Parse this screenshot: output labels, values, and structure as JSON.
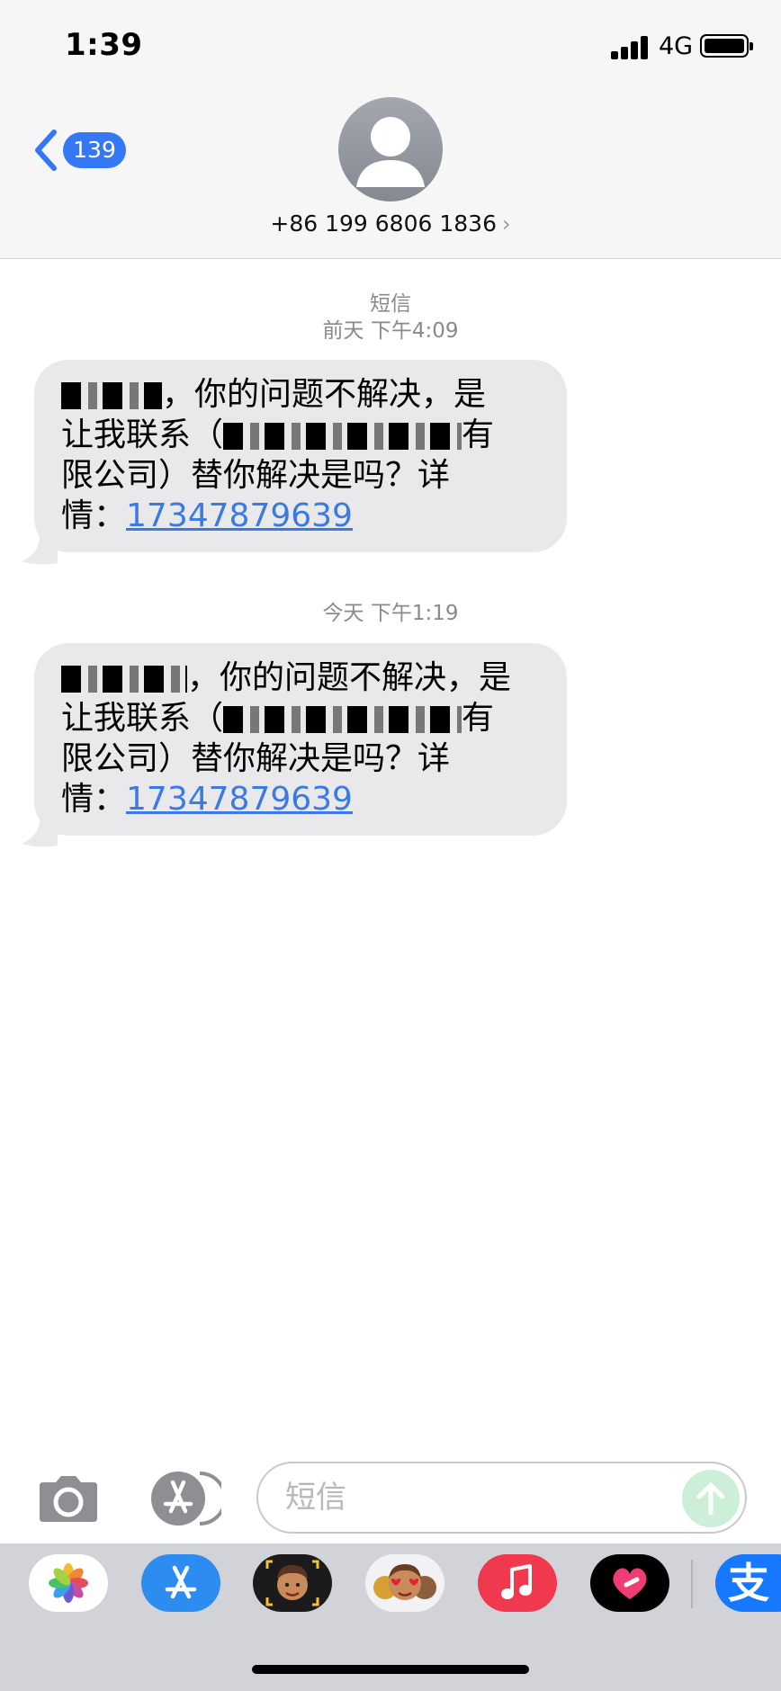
{
  "status_bar": {
    "time": "1:39",
    "network": "4G"
  },
  "nav": {
    "back_count": "139",
    "contact_number": "+86 199 6806 1836"
  },
  "thread": {
    "service_label": "短信",
    "messages": [
      {
        "timestamp": "前天 下午4:09",
        "line1": "，你的问题不解决，是",
        "line2_start": "让我联系（",
        "line2_end": "有",
        "line3": "限公司）替你解决是吗？详",
        "line4_prefix": "情：",
        "link": "17347879639"
      },
      {
        "timestamp": "今天 下午1:19",
        "line1": "，你的问题不解决，是",
        "line2_start": "让我联系（",
        "line2_end": "有",
        "line3": "限公司）替你解决是吗？详",
        "line4_prefix": "情：",
        "link": "17347879639"
      }
    ]
  },
  "composer": {
    "placeholder": "短信"
  },
  "app_drawer": {
    "apps": [
      "photos-icon",
      "app-store-icon",
      "memoji-icon",
      "animoji-stickers-icon",
      "music-icon",
      "digital-touch-icon",
      "alipay-icon"
    ],
    "alipay_glyph": "支"
  },
  "colors": {
    "accent": "#3478f6",
    "bubble": "#e9e9eb",
    "link": "#3b79e3",
    "send_disabled": "#cdeed7"
  }
}
